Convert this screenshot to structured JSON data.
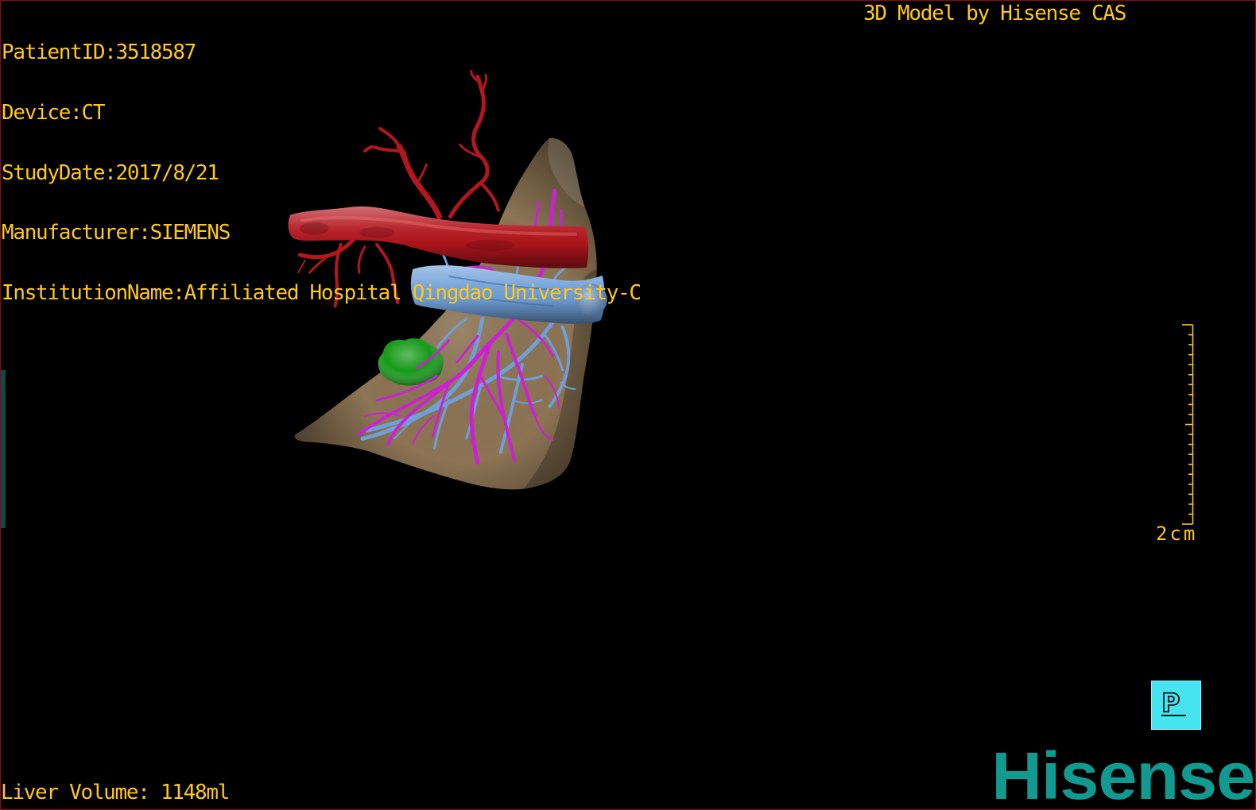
{
  "viewer": {
    "study_info": [
      {
        "label": "PatientID:",
        "value": "3518587"
      },
      {
        "label": "Device:",
        "value": "CT"
      },
      {
        "label": "StudyDate:",
        "value": "2017/8/21"
      },
      {
        "label": "Manufacturer:",
        "value": "SIEMENS"
      },
      {
        "label": "InstitutionName:",
        "value": "Affiliated Hospital Qingdao University-C"
      }
    ],
    "watermark": "3D Model by Hisense CAS",
    "liver_volume": {
      "label": "Liver Volume: ",
      "value": "1148ml"
    },
    "scale_bar": {
      "label": "2cm"
    },
    "orientation_marker": {
      "label": "P",
      "icon": "orientation-cube-icon"
    },
    "logo": {
      "text": "Hisense"
    }
  },
  "colors": {
    "background": "#000000",
    "frame_border": "#8A0B14",
    "overlay_text": "#FFC81A",
    "orientation_marker": "#46E4F0",
    "logo": "#119A8F",
    "side_handle": "#0C4A4A",
    "liver": "#8C7454",
    "red_vessels": "#B3161D",
    "blue_vessels": "#6F9FD8",
    "magenta_vessels": "#CD20D6",
    "green_structure": "#169A18"
  }
}
